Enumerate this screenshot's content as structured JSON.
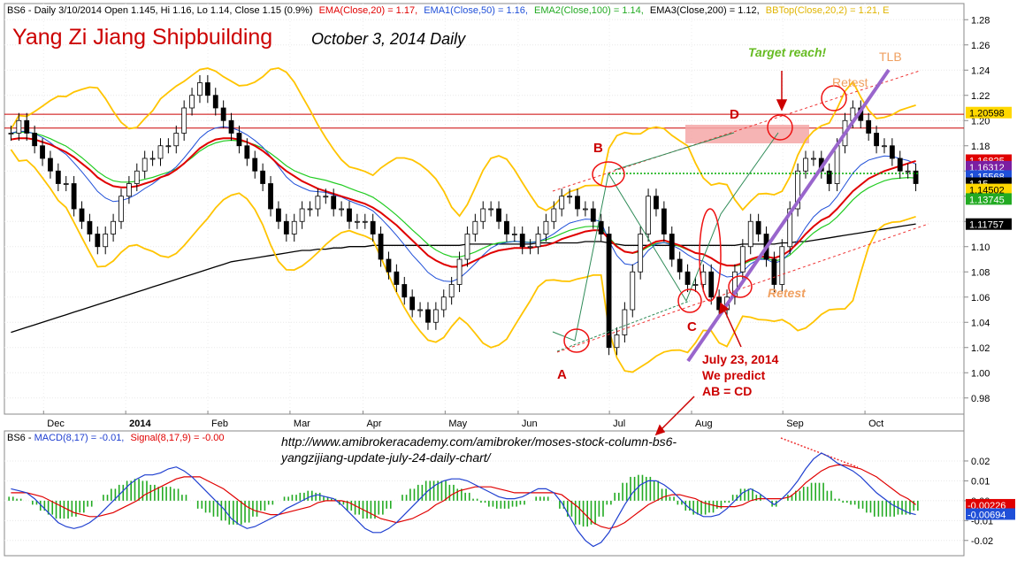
{
  "header": {
    "price_info": "BS6 - Daily 3/10/2014 Open 1.145, Hi 1.16, Lo 1.14, Close 1.15 (0.9%)",
    "ema20": "EMA(Close,20) = 1.17,",
    "ema50": "EMA1(Close,50) = 1.16,",
    "ema100": "EMA2(Close,100) = 1.14,",
    "ema200": "EMA3(Close,200) = 1.12,",
    "bbtop": "BBTop(Close,20,2) = 1.21, E",
    "macd_prefix": "BS6 - ",
    "macd": "MACD(8,17) = -0.01,",
    "signal": "Signal(8,17,9) = -0.00"
  },
  "title": "Yang Zi Jiang  Shipbuilding",
  "subtitle": "October 3, 2014 Daily",
  "url_line1": "http://www.amibrokeracademy.com/amibroker/moses-stock-column-bs6-",
  "url_line2": "yangzijiang-update-july-24-daily-chart/",
  "annotations": {
    "A": "A",
    "B": "B",
    "C": "C",
    "D": "D",
    "target": "Target reach!",
    "retest1": "Retest",
    "retest2": "Retest",
    "tlb": "TLB",
    "predict1": "July 23, 2014",
    "predict2": "We predict",
    "predict3": "AB = CD"
  },
  "price_tags": [
    {
      "text": "1.20598",
      "bg": "#ffd700",
      "fg": "#000000",
      "value": 1.20598
    },
    {
      "text": "1.16825",
      "bg": "#e00000",
      "fg": "#ffffff",
      "value": 1.16825
    },
    {
      "text": "1.16312",
      "bg": "#7b1fa2",
      "fg": "#ffffff",
      "value": 1.16312
    },
    {
      "text": "1.15568",
      "bg": "#1f4fd8",
      "fg": "#ffffff",
      "value": 1.15568
    },
    {
      "text": "1.15",
      "bg": "#000000",
      "fg": "#ffffff",
      "value": 1.15
    },
    {
      "text": "1.14502",
      "bg": "#ffd700",
      "fg": "#000000",
      "value": 1.14502
    },
    {
      "text": "1.13745",
      "bg": "#22aa22",
      "fg": "#ffffff",
      "value": 1.13745
    },
    {
      "text": "1.11757",
      "bg": "#000000",
      "fg": "#ffffff",
      "value": 1.11757
    }
  ],
  "macd_tags": [
    {
      "text": "-0.00226",
      "bg": "#e00000",
      "fg": "#ffffff",
      "value": -0.00226
    },
    {
      "text": "-0.00694",
      "bg": "#1f4fd8",
      "fg": "#ffffff",
      "value": -0.00694
    }
  ],
  "colors": {
    "price": "#000000",
    "ema20": "#e00000",
    "ema50": "#1f4fd8",
    "ema100": "#22cc22",
    "ema200": "#000000",
    "bb": "#ffc400",
    "bbtop_label": "#ffd700",
    "macd": "#1f3fd0",
    "signal": "#e00000",
    "hist": "#22aa22",
    "annot_red": "#cc0000",
    "annot_orange": "#f0a060",
    "annot_green": "#66bb22",
    "trendline": "#9966cc"
  },
  "chart_data": [
    {
      "type": "candlestick",
      "y_ticks": [
        "1.28",
        "1.26",
        "1.24",
        "1.22",
        "1.20",
        "1.18",
        "1.16",
        "1.14",
        "1.12",
        "1.10",
        "1.08",
        "1.06",
        "1.04",
        "1.02",
        "1.00",
        "0.98"
      ],
      "ylim": [
        0.97,
        1.29
      ],
      "x_ticks": [
        "Dec",
        "2014",
        "Jan",
        "Feb",
        "Mar",
        "Apr",
        "May",
        "Jun",
        "Jul",
        "Aug",
        "Sep",
        "Oct"
      ],
      "horizontal_lines": [
        1.205,
        1.194
      ],
      "close": [
        1.19,
        1.2,
        1.19,
        1.18,
        1.17,
        1.16,
        1.15,
        1.15,
        1.13,
        1.12,
        1.11,
        1.1,
        1.11,
        1.12,
        1.14,
        1.15,
        1.16,
        1.17,
        1.17,
        1.18,
        1.18,
        1.19,
        1.21,
        1.22,
        1.23,
        1.22,
        1.21,
        1.2,
        1.19,
        1.18,
        1.17,
        1.16,
        1.15,
        1.13,
        1.12,
        1.11,
        1.12,
        1.13,
        1.13,
        1.14,
        1.14,
        1.13,
        1.13,
        1.12,
        1.12,
        1.12,
        1.11,
        1.09,
        1.08,
        1.07,
        1.06,
        1.05,
        1.05,
        1.04,
        1.05,
        1.06,
        1.07,
        1.09,
        1.11,
        1.12,
        1.13,
        1.13,
        1.12,
        1.11,
        1.11,
        1.1,
        1.1,
        1.11,
        1.12,
        1.13,
        1.14,
        1.14,
        1.13,
        1.13,
        1.12,
        1.11,
        1.02,
        1.03,
        1.05,
        1.08,
        1.11,
        1.14,
        1.13,
        1.11,
        1.09,
        1.08,
        1.07,
        1.07,
        1.08,
        1.06,
        1.05,
        1.06,
        1.08,
        1.1,
        1.12,
        1.11,
        1.09,
        1.07,
        1.1,
        1.13,
        1.16,
        1.17,
        1.17,
        1.16,
        1.15,
        1.18,
        1.2,
        1.21,
        1.2,
        1.19,
        1.18,
        1.18,
        1.17,
        1.16,
        1.16,
        1.15
      ],
      "ema20": [
        1.185,
        1.186,
        1.186,
        1.185,
        1.183,
        1.181,
        1.178,
        1.175,
        1.171,
        1.166,
        1.161,
        1.155,
        1.151,
        1.148,
        1.147,
        1.147,
        1.148,
        1.15,
        1.152,
        1.155,
        1.157,
        1.161,
        1.166,
        1.172,
        1.178,
        1.182,
        1.185,
        1.186,
        1.186,
        1.185,
        1.183,
        1.18,
        1.176,
        1.171,
        1.165,
        1.16,
        1.156,
        1.152,
        1.149,
        1.146,
        1.144,
        1.142,
        1.14,
        1.138,
        1.136,
        1.134,
        1.131,
        1.127,
        1.122,
        1.117,
        1.111,
        1.105,
        1.099,
        1.093,
        1.089,
        1.086,
        1.084,
        1.084,
        1.086,
        1.089,
        1.092,
        1.095,
        1.097,
        1.098,
        1.099,
        1.099,
        1.099,
        1.1,
        1.101,
        1.103,
        1.106,
        1.108,
        1.11,
        1.112,
        1.113,
        1.113,
        1.106,
        1.1,
        1.096,
        1.095,
        1.097,
        1.101,
        1.104,
        1.105,
        1.103,
        1.101,
        1.098,
        1.095,
        1.094,
        1.091,
        1.087,
        1.085,
        1.085,
        1.087,
        1.09,
        1.092,
        1.092,
        1.091,
        1.093,
        1.097,
        1.103,
        1.11,
        1.116,
        1.121,
        1.124,
        1.13,
        1.137,
        1.144,
        1.149,
        1.154,
        1.157,
        1.16,
        1.162,
        1.164,
        1.166,
        1.168
      ],
      "ema200": [
        1.032,
        1.034,
        1.036,
        1.038,
        1.04,
        1.042,
        1.044,
        1.046,
        1.048,
        1.05,
        1.052,
        1.054,
        1.056,
        1.058,
        1.06,
        1.062,
        1.064,
        1.066,
        1.068,
        1.07,
        1.072,
        1.074,
        1.076,
        1.078,
        1.08,
        1.082,
        1.084,
        1.086,
        1.088,
        1.089,
        1.09,
        1.091,
        1.092,
        1.093,
        1.094,
        1.095,
        1.096,
        1.097,
        1.097,
        1.098,
        1.098,
        1.099,
        1.099,
        1.1,
        1.1,
        1.1,
        1.101,
        1.101,
        1.101,
        1.101,
        1.101,
        1.101,
        1.101,
        1.101,
        1.101,
        1.101,
        1.101,
        1.101,
        1.102,
        1.102,
        1.102,
        1.102,
        1.102,
        1.102,
        1.102,
        1.102,
        1.102,
        1.103,
        1.103,
        1.103,
        1.103,
        1.103,
        1.103,
        1.104,
        1.104,
        1.104,
        1.103,
        1.102,
        1.101,
        1.101,
        1.101,
        1.101,
        1.101,
        1.101,
        1.101,
        1.101,
        1.101,
        1.101,
        1.101,
        1.101,
        1.101,
        1.101,
        1.101,
        1.102,
        1.102,
        1.102,
        1.102,
        1.102,
        1.103,
        1.103,
        1.104,
        1.104,
        1.105,
        1.106,
        1.107,
        1.108,
        1.109,
        1.11,
        1.111,
        1.112,
        1.113,
        1.114,
        1.115,
        1.116,
        1.117,
        1.118
      ]
    },
    {
      "type": "macd",
      "y_ticks": [
        "0.02",
        "0.01",
        "0.00",
        "-0.01",
        "-0.02"
      ],
      "ylim": [
        -0.025,
        0.028
      ],
      "macd": [
        0.006,
        0.005,
        0.004,
        0.001,
        -0.003,
        -0.007,
        -0.011,
        -0.013,
        -0.014,
        -0.013,
        -0.011,
        -0.008,
        -0.004,
        0.0,
        0.004,
        0.008,
        0.011,
        0.013,
        0.013,
        0.014,
        0.016,
        0.017,
        0.015,
        0.012,
        0.008,
        0.004,
        0.0,
        -0.004,
        -0.009,
        -0.012,
        -0.014,
        -0.013,
        -0.011,
        -0.009,
        -0.007,
        -0.004,
        -0.002,
        0.0,
        0.002,
        0.003,
        0.002,
        0.001,
        -0.002,
        -0.006,
        -0.01,
        -0.014,
        -0.016,
        -0.016,
        -0.014,
        -0.011,
        -0.007,
        -0.003,
        0.001,
        0.005,
        0.008,
        0.01,
        0.011,
        0.011,
        0.01,
        0.008,
        0.006,
        0.004,
        0.002,
        0.001,
        0.001,
        0.002,
        0.004,
        0.006,
        0.006,
        0.004,
        -0.001,
        -0.008,
        -0.015,
        -0.02,
        -0.023,
        -0.021,
        -0.016,
        -0.009,
        -0.002,
        0.004,
        0.008,
        0.01,
        0.01,
        0.008,
        0.005,
        0.001,
        -0.003,
        -0.006,
        -0.008,
        -0.008,
        -0.007,
        -0.004,
        0.0,
        0.004,
        0.006,
        0.004,
        0.001,
        -0.002,
        0.001,
        0.005,
        0.01,
        0.016,
        0.021,
        0.024,
        0.022,
        0.019,
        0.017,
        0.015,
        0.012,
        0.008,
        0.004,
        0.001,
        -0.002,
        -0.004,
        -0.006,
        -0.007
      ],
      "signal": [
        0.004,
        0.004,
        0.004,
        0.003,
        0.002,
        0.0,
        -0.002,
        -0.004,
        -0.006,
        -0.007,
        -0.008,
        -0.008,
        -0.007,
        -0.006,
        -0.004,
        -0.002,
        0.0,
        0.003,
        0.005,
        0.007,
        0.009,
        0.011,
        0.012,
        0.012,
        0.012,
        0.01,
        0.008,
        0.006,
        0.003,
        0.0,
        -0.003,
        -0.005,
        -0.006,
        -0.007,
        -0.007,
        -0.006,
        -0.005,
        -0.004,
        -0.003,
        -0.001,
        0.0,
        0.0,
        0.0,
        -0.001,
        -0.003,
        -0.005,
        -0.007,
        -0.009,
        -0.01,
        -0.011,
        -0.01,
        -0.009,
        -0.007,
        -0.005,
        -0.002,
        0.0,
        0.003,
        0.005,
        0.006,
        0.007,
        0.007,
        0.007,
        0.006,
        0.005,
        0.004,
        0.004,
        0.004,
        0.004,
        0.004,
        0.004,
        0.003,
        0.0,
        -0.003,
        -0.007,
        -0.011,
        -0.013,
        -0.014,
        -0.013,
        -0.011,
        -0.008,
        -0.005,
        -0.002,
        0.0,
        0.002,
        0.003,
        0.003,
        0.002,
        0.001,
        -0.001,
        -0.002,
        -0.003,
        -0.003,
        -0.003,
        -0.002,
        0.0,
        0.001,
        0.001,
        0.001,
        0.001,
        0.002,
        0.005,
        0.009,
        0.012,
        0.015,
        0.017,
        0.018,
        0.018,
        0.017,
        0.016,
        0.014,
        0.012,
        0.009,
        0.006,
        0.003,
        0.001,
        -0.002
      ]
    }
  ]
}
